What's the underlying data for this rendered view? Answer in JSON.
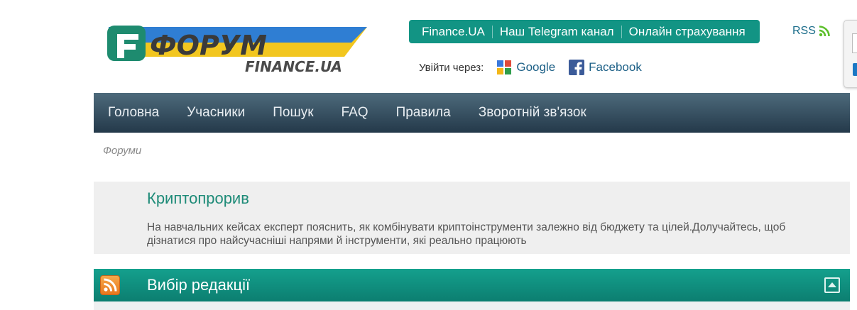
{
  "logo": {
    "text": "ФОРУМ",
    "subtext": "FINANCE.UA"
  },
  "top_links": [
    "Finance.UA",
    "Наш Telegram канал",
    "Онлайн страхування"
  ],
  "rss_label": "RSS",
  "login": {
    "label": "Увійти через:",
    "google": "Google",
    "facebook": "Facebook"
  },
  "nav": [
    "Головна",
    "Учасники",
    "Пошук",
    "FAQ",
    "Правила",
    "Зворотній зв'язок"
  ],
  "breadcrumb": "Форуми",
  "promo": {
    "title": "Криптопрорив",
    "text": "На навчальних кейсах експерт пояснить, як комбінувати криптоінструменти залежно від бюджету та цілей.Долучайтесь, щоб дізнатися про найсучасніші напрями й інструменти, які реально працюють"
  },
  "section": {
    "title": "Вибір редакції"
  },
  "colors": {
    "accent": "#129484",
    "nav": "#2f4859",
    "link": "#1b5f86"
  }
}
